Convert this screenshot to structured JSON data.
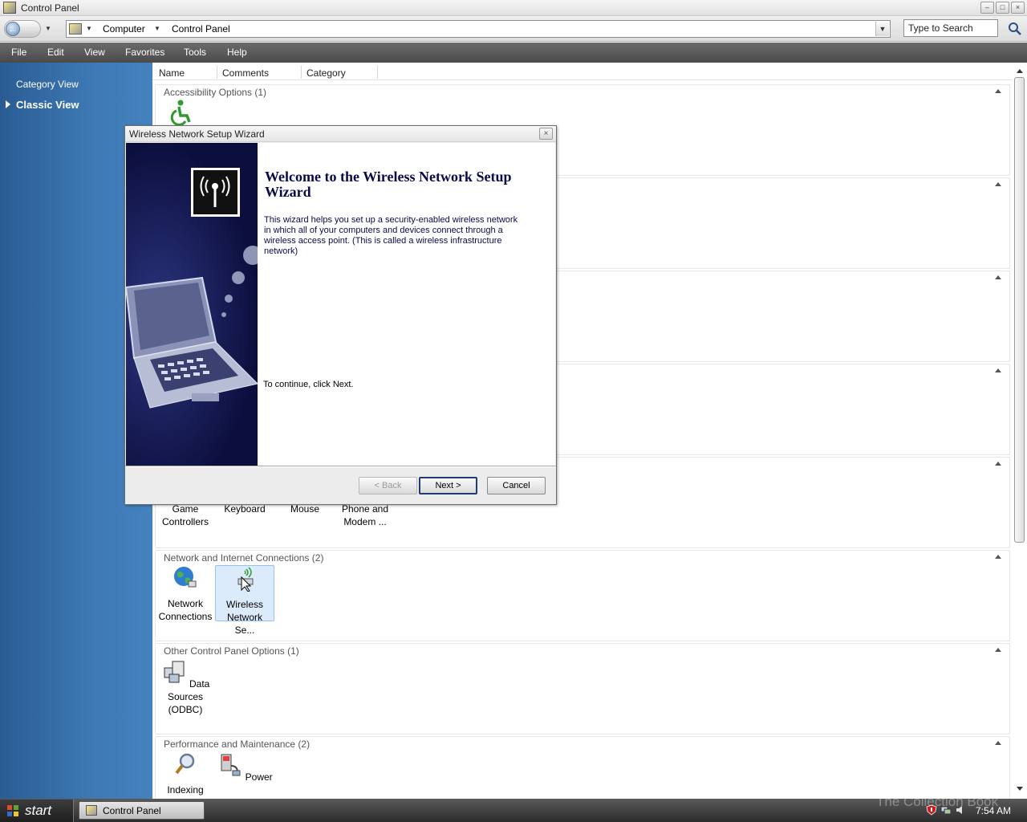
{
  "window": {
    "title": "Control Panel"
  },
  "address": {
    "crumbs": [
      "Computer",
      "Control Panel"
    ],
    "search_placeholder": "Type to Search"
  },
  "menu": [
    "File",
    "Edit",
    "View",
    "Favorites",
    "Tools",
    "Help"
  ],
  "sidebar": {
    "items": [
      {
        "label": "Category View"
      },
      {
        "label": "Classic View"
      }
    ]
  },
  "columns": [
    "Name",
    "Comments",
    "Category"
  ],
  "groups": {
    "accessibility": {
      "title": "Accessibility Options (1)"
    },
    "printers_items": [
      {
        "label": "Game Controllers"
      },
      {
        "label": "Keyboard"
      },
      {
        "label": "Mouse"
      },
      {
        "label": "Phone and Modem ..."
      }
    ],
    "network": {
      "title": "Network and Internet Connections (2)",
      "items": [
        {
          "label": "Network Connections"
        },
        {
          "label": "Wireless Network Se..."
        }
      ]
    },
    "other": {
      "title": "Other Control Panel Options (1)",
      "items": [
        {
          "label": "Data Sources (ODBC)"
        }
      ]
    },
    "performance": {
      "title": "Performance and Maintenance (2)",
      "items": [
        {
          "label": "Indexing"
        },
        {
          "label": "Power"
        }
      ]
    }
  },
  "dialog": {
    "title": "Wireless Network Setup Wizard",
    "heading": "Welcome to the Wireless Network Setup Wizard",
    "description": "This wizard helps you set up a security-enabled wireless network in which all of your computers and devices connect through a wireless access point. (This is called a wireless infrastructure network)",
    "continue": "To continue, click Next.",
    "back": "< Back",
    "next": "Next >",
    "cancel": "Cancel"
  },
  "taskbar": {
    "start": "start",
    "task": "Control Panel",
    "clock": "7:54 AM",
    "watermark": "The Collection Book"
  },
  "colors": {
    "sidebar": "#3e79b4",
    "menubar": "#4a4a4a",
    "banner": "#0c0f3e",
    "heading": "#0a0a4a"
  }
}
